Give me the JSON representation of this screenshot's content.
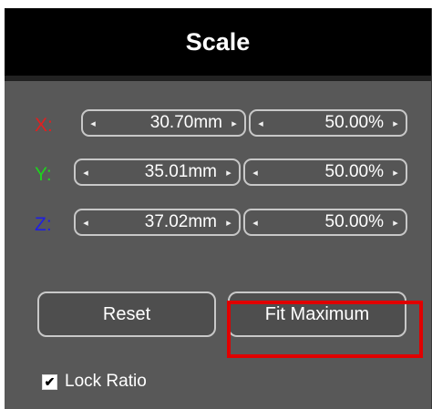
{
  "panel": {
    "title": "Scale"
  },
  "rows": [
    {
      "axis": "X:",
      "color": "#e02020",
      "size": "30.70mm",
      "percent": "50.00%"
    },
    {
      "axis": "Y:",
      "color": "#20d020",
      "size": "35.01mm",
      "percent": "50.00%"
    },
    {
      "axis": "Z:",
      "color": "#2020e0",
      "size": "37.02mm",
      "percent": "50.00%"
    }
  ],
  "icons": {
    "decrement": "◂",
    "increment": "▸",
    "check": "✔"
  },
  "buttons": {
    "reset": "Reset",
    "fit_maximum": "Fit Maximum"
  },
  "lock_ratio": {
    "label": "Lock Ratio",
    "checked": true
  },
  "highlight_color": "#e00000"
}
